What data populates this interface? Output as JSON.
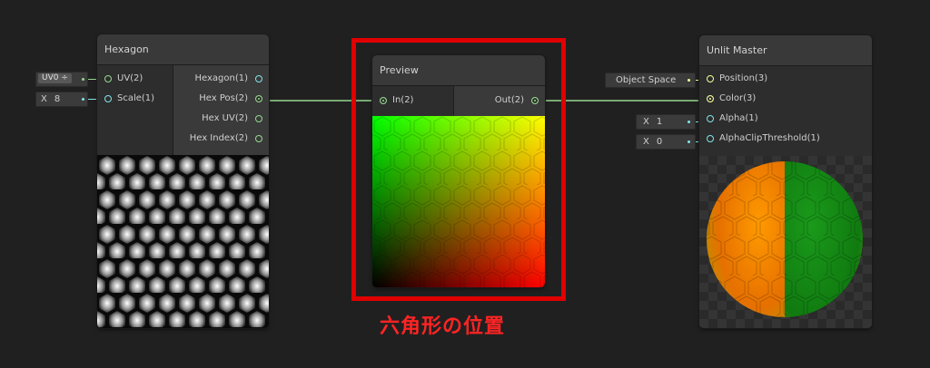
{
  "colors": {
    "canvas": "#202020",
    "node_bg": "#2d2d2d",
    "vector2_port": "#96d890",
    "vector1_port": "#84e4e7",
    "vector3_port": "#f6ff9a",
    "highlight": "#e00000",
    "caption": "#ff2424"
  },
  "hexagon_node": {
    "title": "Hexagon",
    "inputs": [
      {
        "label": "UV(2)",
        "port_type": "vector2"
      },
      {
        "label": "Scale(1)",
        "port_type": "vector1"
      }
    ],
    "outputs": [
      {
        "label": "Hexagon(1)",
        "port_type": "vector1"
      },
      {
        "label": "Hex Pos(2)",
        "port_type": "vector2",
        "connected": true
      },
      {
        "label": "Hex UV(2)",
        "port_type": "vector2"
      },
      {
        "label": "Hex Index(2)",
        "port_type": "vector2"
      }
    ],
    "uv_dropdown": "UV0 ÷",
    "scale_field": {
      "axis": "X",
      "value": "8"
    }
  },
  "preview_node": {
    "title": "Preview",
    "input": "In(2)",
    "output": "Out(2)"
  },
  "master_node": {
    "title": "Unlit Master",
    "inputs": [
      {
        "label": "Position(3)",
        "port_type": "vector3"
      },
      {
        "label": "Color(3)",
        "port_type": "vector3",
        "connected": true
      },
      {
        "label": "Alpha(1)",
        "port_type": "vector1"
      },
      {
        "label": "AlphaClipThreshold(1)",
        "port_type": "vector1"
      }
    ],
    "space_field": "Object Space",
    "alpha_field": {
      "axis": "X",
      "value": "1"
    },
    "clip_field": {
      "axis": "X",
      "value": "0"
    }
  },
  "caption": "六角形の位置",
  "icons": [
    "port-icon",
    "dropdown-arrow-icon"
  ]
}
